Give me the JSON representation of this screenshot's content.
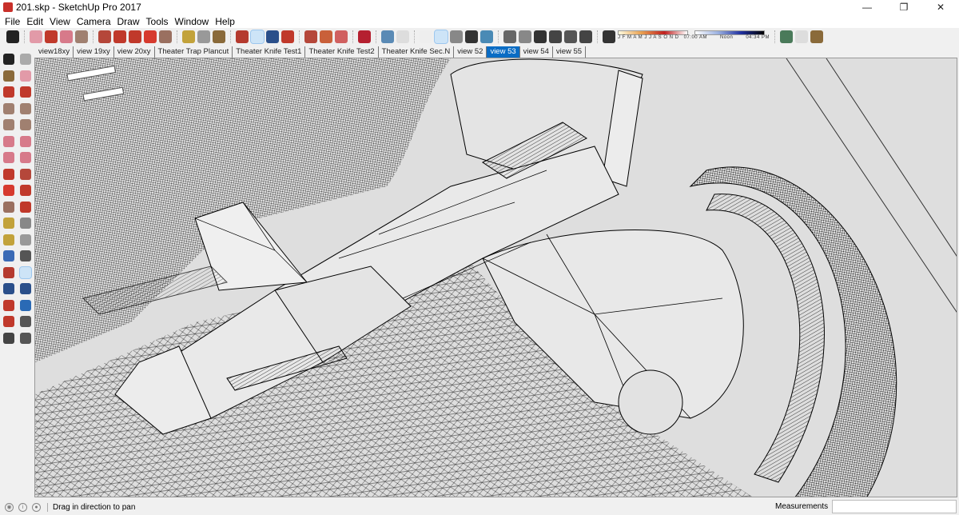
{
  "window": {
    "title": "201.skp - SketchUp Pro 2017",
    "minimize": "—",
    "maximize": "❐",
    "close": "✕"
  },
  "menu": [
    "File",
    "Edit",
    "View",
    "Camera",
    "Draw",
    "Tools",
    "Window",
    "Help"
  ],
  "toolbar": {
    "icons": [
      {
        "name": "select-icon",
        "color": "#222"
      },
      "sep",
      {
        "name": "eraser-icon",
        "color": "#e29aa8"
      },
      {
        "name": "pencil-icon",
        "color": "#c0392b"
      },
      {
        "name": "arc-icon",
        "color": "#d77a8a"
      },
      {
        "name": "rectangle-icon",
        "color": "#a08070"
      },
      "sep",
      {
        "name": "push-pull-icon",
        "color": "#b5473a"
      },
      {
        "name": "follow-me-icon",
        "color": "#c0392b"
      },
      {
        "name": "move-icon",
        "color": "#c0392b"
      },
      {
        "name": "rotate-icon",
        "color": "#d63a2e"
      },
      {
        "name": "scale-icon",
        "color": "#9a7060"
      },
      "sep",
      {
        "name": "tape-measure-icon",
        "color": "#c2a23a"
      },
      {
        "name": "text-icon",
        "color": "#999"
      },
      {
        "name": "paint-bucket-icon",
        "color": "#8a6a3a"
      },
      "sep",
      {
        "name": "orbit-icon",
        "color": "#b53a2e"
      },
      {
        "name": "pan-icon",
        "color": "#e8d3a8",
        "selected": true
      },
      {
        "name": "zoom-icon",
        "color": "#2a4f8a"
      },
      {
        "name": "zoom-extents-icon",
        "color": "#c0392b"
      },
      "sep",
      {
        "name": "warehouse-icon",
        "color": "#b5473a"
      },
      {
        "name": "extension-warehouse-icon",
        "color": "#c9603a"
      },
      {
        "name": "share-model-icon",
        "color": "#d06060"
      },
      "sep",
      {
        "name": "ruby-icon",
        "color": "#b52030"
      },
      "sep",
      {
        "name": "xray-icon",
        "color": "#5a8ab5"
      },
      {
        "name": "back-edges-icon",
        "color": "#ddd"
      },
      "sep",
      {
        "name": "wireframe-icon",
        "color": "#eee"
      },
      {
        "name": "hidden-line-icon",
        "color": "#fff",
        "selected": true
      },
      {
        "name": "shaded-icon",
        "color": "#888"
      },
      {
        "name": "shaded-textures-icon",
        "color": "#333"
      },
      {
        "name": "monochrome-icon",
        "color": "#4a8ab5"
      },
      "sep",
      {
        "name": "iso-view-icon",
        "color": "#666"
      },
      {
        "name": "top-view-icon",
        "color": "#888"
      },
      {
        "name": "front-view-icon",
        "color": "#333"
      },
      {
        "name": "right-view-icon",
        "color": "#444"
      },
      {
        "name": "back-view-icon",
        "color": "#555"
      },
      {
        "name": "left-view-icon",
        "color": "#444"
      },
      "sep",
      {
        "name": "shadows-toggle-icon",
        "color": "#333"
      },
      "shadow",
      "sep",
      {
        "name": "geo-location-icon",
        "color": "#4a7a5a"
      },
      {
        "name": "sandbox-icon",
        "color": "#ddd"
      },
      {
        "name": "add-location-icon",
        "color": "#8a6a3a"
      }
    ],
    "shadow": {
      "months": "J F M A M J J A S O N D",
      "time_start": "07:00 AM",
      "time_mid": "Noon",
      "time_end": "04:34 PM"
    }
  },
  "tabs": [
    "view18xy",
    "view 19xy",
    "view 20xy",
    "Theater Trap Plancut",
    "Theater Knife Test1",
    "Theater Knife Test2",
    "Theater Knife Sec.N",
    "view 52",
    "view 53",
    "view 54",
    "view 55"
  ],
  "active_tab": "view 53",
  "left_toolbar": [
    {
      "name": "select-icon",
      "color": "#222"
    },
    {
      "name": "make-component-icon",
      "color": "#aaa"
    },
    {
      "name": "paint-bucket-icon",
      "color": "#8a6a3a"
    },
    {
      "name": "eraser-icon",
      "color": "#e29aa8"
    },
    {
      "name": "line-icon",
      "color": "#c0392b"
    },
    {
      "name": "freehand-icon",
      "color": "#c0392b"
    },
    {
      "name": "rectangle-icon",
      "color": "#a08070"
    },
    {
      "name": "rotated-rectangle-icon",
      "color": "#a08070"
    },
    {
      "name": "circle-icon",
      "color": "#a08070"
    },
    {
      "name": "polygon-icon",
      "color": "#a08070"
    },
    {
      "name": "arc-icon",
      "color": "#d77a8a"
    },
    {
      "name": "pie-icon",
      "color": "#d77a8a"
    },
    {
      "name": "three-point-arc-icon",
      "color": "#d77a8a"
    },
    {
      "name": "two-point-arc-icon",
      "color": "#d77a8a"
    },
    {
      "name": "move-icon",
      "color": "#c0392b"
    },
    {
      "name": "push-pull-icon",
      "color": "#b5473a"
    },
    {
      "name": "rotate-icon",
      "color": "#d63a2e"
    },
    {
      "name": "follow-me-icon",
      "color": "#c0392b"
    },
    {
      "name": "scale-icon",
      "color": "#9a7060"
    },
    {
      "name": "offset-icon",
      "color": "#c0392b"
    },
    {
      "name": "tape-measure-icon",
      "color": "#c2a23a"
    },
    {
      "name": "dimension-icon",
      "color": "#888"
    },
    {
      "name": "protractor-icon",
      "color": "#c2a23a"
    },
    {
      "name": "text-icon",
      "color": "#999"
    },
    {
      "name": "axes-icon",
      "color": "#3a6ab5"
    },
    {
      "name": "3d-text-icon",
      "color": "#555"
    },
    {
      "name": "orbit-icon",
      "color": "#b53a2e"
    },
    {
      "name": "pan-icon",
      "color": "#e8d3a8",
      "selected": true
    },
    {
      "name": "zoom-icon",
      "color": "#2a4f8a"
    },
    {
      "name": "zoom-window-icon",
      "color": "#2a4f8a"
    },
    {
      "name": "zoom-extents-icon",
      "color": "#c0392b"
    },
    {
      "name": "previous-view-icon",
      "color": "#2a6ab5"
    },
    {
      "name": "position-camera-icon",
      "color": "#c0392b"
    },
    {
      "name": "look-around-icon",
      "color": "#555"
    },
    {
      "name": "walk-icon",
      "color": "#444"
    },
    {
      "name": "section-plane-icon",
      "color": "#555"
    }
  ],
  "status": {
    "text": "Drag in direction to pan",
    "measurements_label": "Measurements",
    "measurements_value": ""
  },
  "colors": {
    "active_tab": "#0a6cc4",
    "viewport_bg": "#dcdcdc",
    "edges": "#000000"
  }
}
